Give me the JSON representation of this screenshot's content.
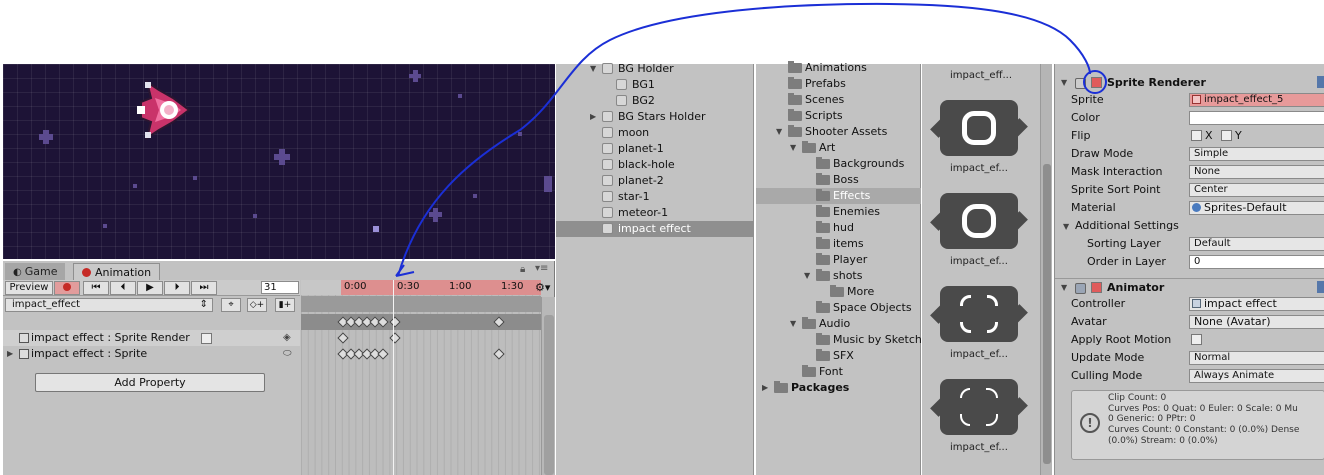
{
  "animation_window": {
    "tabs": [
      {
        "label": "Game"
      },
      {
        "label": "Animation"
      }
    ],
    "preview_label": "Preview",
    "frame_value": "31",
    "clip_name": "impact_effect",
    "properties": [
      {
        "label": "impact effect : Sprite Render"
      },
      {
        "label": "impact effect : Sprite"
      }
    ],
    "add_property_label": "Add Property",
    "ruler_labels": [
      "0:00",
      "0:30",
      "1:00",
      "1:30"
    ]
  },
  "hierarchy": {
    "items": [
      {
        "label": "BG Holder"
      },
      {
        "label": "BG1"
      },
      {
        "label": "BG2"
      },
      {
        "label": "BG Stars Holder"
      },
      {
        "label": "moon"
      },
      {
        "label": "planet-1"
      },
      {
        "label": "black-hole"
      },
      {
        "label": "planet-2"
      },
      {
        "label": "star-1"
      },
      {
        "label": "meteor-1"
      },
      {
        "label": "impact effect"
      }
    ]
  },
  "project": {
    "folders": [
      {
        "label": "Animations"
      },
      {
        "label": "Prefabs"
      },
      {
        "label": "Scenes"
      },
      {
        "label": "Scripts"
      },
      {
        "label": "Shooter Assets"
      },
      {
        "label": "Art"
      },
      {
        "label": "Backgrounds"
      },
      {
        "label": "Boss"
      },
      {
        "label": "Effects"
      },
      {
        "label": "Enemies"
      },
      {
        "label": "hud"
      },
      {
        "label": "items"
      },
      {
        "label": "Player"
      },
      {
        "label": "shots"
      },
      {
        "label": "More"
      },
      {
        "label": "Space Objects"
      },
      {
        "label": "Audio"
      },
      {
        "label": "Music by Sketch"
      },
      {
        "label": "SFX"
      },
      {
        "label": "Font"
      },
      {
        "label": "Packages"
      }
    ],
    "assets": [
      {
        "label": "impact_eff..."
      },
      {
        "label": "impact_ef..."
      },
      {
        "label": "impact_ef..."
      },
      {
        "label": "impact_ef..."
      },
      {
        "label": "impact_ef..."
      }
    ]
  },
  "inspector": {
    "sprite_renderer": {
      "title": "Sprite Renderer",
      "sprite_label": "Sprite",
      "sprite_value": "impact_effect_5",
      "color_label": "Color",
      "flip_label": "Flip",
      "flip_x": "X",
      "flip_y": "Y",
      "draw_mode_label": "Draw Mode",
      "draw_mode_value": "Simple",
      "mask_label": "Mask Interaction",
      "mask_value": "None",
      "sort_point_label": "Sprite Sort Point",
      "sort_point_value": "Center",
      "material_label": "Material",
      "material_value": "Sprites-Default",
      "additional_label": "Additional Settings",
      "sorting_layer_label": "Sorting Layer",
      "sorting_layer_value": "Default",
      "order_label": "Order in Layer",
      "order_value": "0"
    },
    "animator": {
      "title": "Animator",
      "controller_label": "Controller",
      "controller_value": "impact effect",
      "avatar_label": "Avatar",
      "avatar_value": "None (Avatar)",
      "root_motion_label": "Apply Root Motion",
      "update_label": "Update Mode",
      "update_value": "Normal",
      "culling_label": "Culling Mode",
      "culling_value": "Always Animate",
      "info_text": "Clip Count: 0\nCurves Pos: 0 Quat: 0 Euler: 0 Scale: 0 Mu\n0 Generic: 0 PPtr: 0\nCurves Count: 0 Constant: 0 (0.0%) Dense\n(0.0%) Stream: 0 (0.0%)"
    }
  },
  "colors": {
    "annotation": "#1b2fd6",
    "record_red": "#c62a26",
    "ruler": "#dd8f8f"
  }
}
